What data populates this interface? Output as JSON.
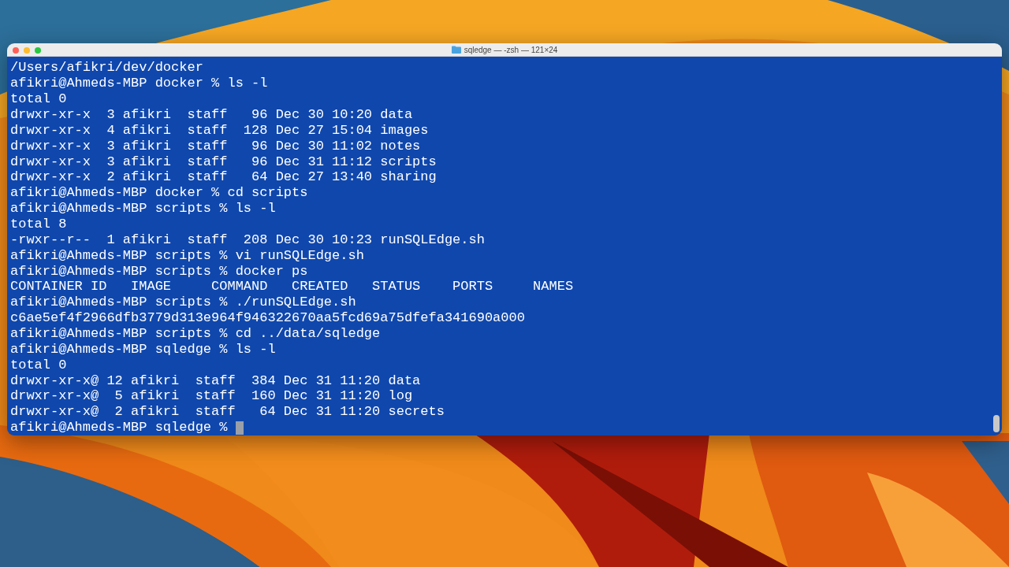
{
  "window": {
    "title": "sqledge — -zsh — 121×24"
  },
  "terminal": {
    "cursor": true,
    "lines": [
      "/Users/afikri/dev/docker",
      "afikri@Ahmeds-MBP docker % ls -l",
      "total 0",
      "drwxr-xr-x  3 afikri  staff   96 Dec 30 10:20 data",
      "drwxr-xr-x  4 afikri  staff  128 Dec 27 15:04 images",
      "drwxr-xr-x  3 afikri  staff   96 Dec 30 11:02 notes",
      "drwxr-xr-x  3 afikri  staff   96 Dec 31 11:12 scripts",
      "drwxr-xr-x  2 afikri  staff   64 Dec 27 13:40 sharing",
      "afikri@Ahmeds-MBP docker % cd scripts",
      "afikri@Ahmeds-MBP scripts % ls -l",
      "total 8",
      "-rwxr--r--  1 afikri  staff  208 Dec 30 10:23 runSQLEdge.sh",
      "afikri@Ahmeds-MBP scripts % vi runSQLEdge.sh",
      "afikri@Ahmeds-MBP scripts % docker ps",
      "CONTAINER ID   IMAGE     COMMAND   CREATED   STATUS    PORTS     NAMES",
      "afikri@Ahmeds-MBP scripts % ./runSQLEdge.sh",
      "c6ae5ef4f2966dfb3779d313e964f946322670aa5fcd69a75dfefa341690a000",
      "afikri@Ahmeds-MBP scripts % cd ../data/sqledge",
      "afikri@Ahmeds-MBP sqledge % ls -l",
      "total 0",
      "drwxr-xr-x@ 12 afikri  staff  384 Dec 31 11:20 data",
      "drwxr-xr-x@  5 afikri  staff  160 Dec 31 11:20 log",
      "drwxr-xr-x@  2 afikri  staff   64 Dec 31 11:20 secrets",
      "afikri@Ahmeds-MBP sqledge % "
    ]
  }
}
